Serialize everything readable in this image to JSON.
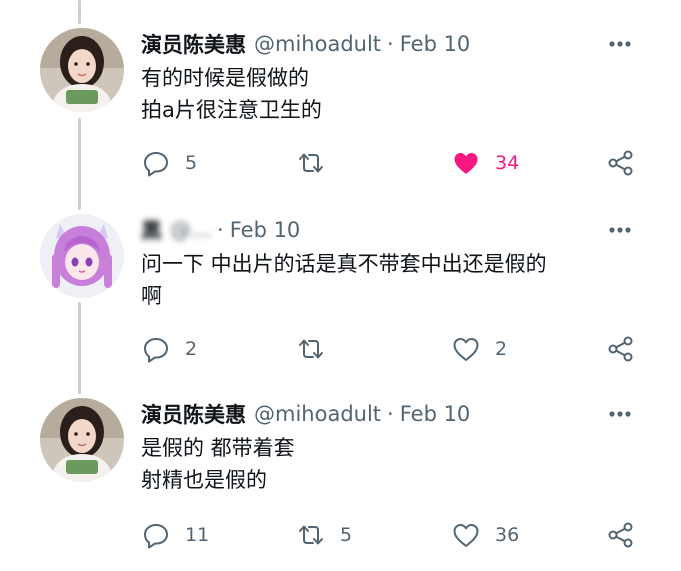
{
  "tweets": [
    {
      "name": "演员陈美惠",
      "handle": "@mihoadult",
      "date": "Feb 10",
      "lines": [
        "有的时候是假做的",
        "拍a片很注意卫生的"
      ],
      "replies": "5",
      "retweets": "",
      "likes": "34",
      "liked": true
    },
    {
      "name": "黑",
      "handle": "@...",
      "date": "Feb 10",
      "lines": [
        "问一下 中出片的话是真不带套中出还是假的",
        "啊"
      ],
      "replies": "2",
      "retweets": "",
      "likes": "2",
      "liked": false
    },
    {
      "name": "演员陈美惠",
      "handle": "@mihoadult",
      "date": "Feb 10",
      "lines": [
        "是假的 都带着套",
        "射精也是假的"
      ],
      "replies": "11",
      "retweets": "5",
      "likes": "36",
      "liked": false
    }
  ],
  "icons": {
    "reply": "reply-icon",
    "retweet": "retweet-icon",
    "like": "heart-icon",
    "share": "share-icon",
    "more": "more-icon"
  },
  "colors": {
    "like_active": "#f91880",
    "secondary_text": "#536471",
    "thread_line": "#c4cfd6"
  }
}
